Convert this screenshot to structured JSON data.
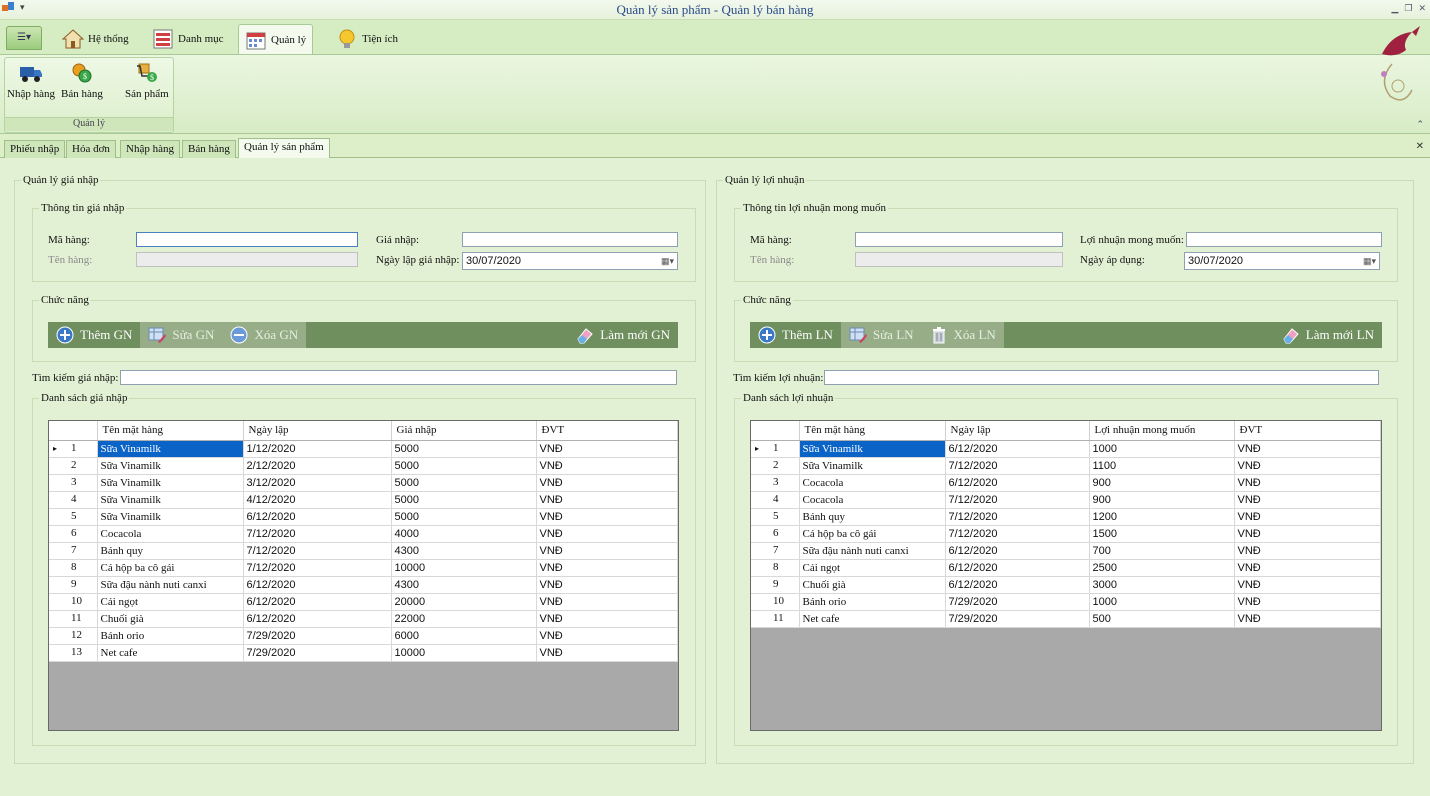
{
  "window": {
    "title": "Quản lý sản phẩm - Quản lý bán hàng"
  },
  "ribbon": {
    "tabs": [
      {
        "label": "Hệ thống"
      },
      {
        "label": "Danh mục"
      },
      {
        "label": "Quản lý"
      },
      {
        "label": "Tiện ích"
      }
    ],
    "active_tab": "Quản lý",
    "group": {
      "name": "Quản lý",
      "buttons": [
        {
          "label": "Nhập hàng",
          "icon": "truck-icon"
        },
        {
          "label": "Bán hàng",
          "icon": "coins-icon"
        },
        {
          "label": "Sản phẩm",
          "icon": "cart-icon"
        }
      ]
    }
  },
  "doc_tabs": [
    {
      "label": "Phiếu nhập"
    },
    {
      "label": "Hóa đơn"
    },
    {
      "label": "Nhập hàng"
    },
    {
      "label": "Bán hàng"
    },
    {
      "label": "Quản lý sản phẩm"
    }
  ],
  "left": {
    "title": "Quản lý giá nhập",
    "info": {
      "title": "Thông tin giá nhập",
      "ma_hang_label": "Mã hàng:",
      "ma_hang_value": "",
      "ten_hang_label": "Tên hàng:",
      "ten_hang_value": "",
      "gia_nhap_label": "Giá nhập:",
      "gia_nhap_value": "",
      "ngay_lap_label": "Ngày lập giá nhập:",
      "ngay_lap_value": "30/07/2020"
    },
    "functions": {
      "title": "Chức năng",
      "add": "Thêm GN",
      "edit": "Sửa GN",
      "delete": "Xóa GN",
      "refresh": "Làm mới GN"
    },
    "search_label": "Tìm kiếm giá nhập:",
    "search_value": "",
    "list": {
      "title": "Danh sách giá nhập",
      "columns": [
        "Tên mặt hàng",
        "Ngày lập",
        "Giá nhập",
        "ĐVT"
      ],
      "rows": [
        [
          "1",
          "Sữa Vinamilk",
          "1/12/2020",
          "5000",
          "VNĐ"
        ],
        [
          "2",
          "Sữa Vinamilk",
          "2/12/2020",
          "5000",
          "VNĐ"
        ],
        [
          "3",
          "Sữa Vinamilk",
          "3/12/2020",
          "5000",
          "VNĐ"
        ],
        [
          "4",
          "Sữa Vinamilk",
          "4/12/2020",
          "5000",
          "VNĐ"
        ],
        [
          "5",
          "Sữa Vinamilk",
          "6/12/2020",
          "5000",
          "VNĐ"
        ],
        [
          "6",
          "Cocacola",
          "7/12/2020",
          "4000",
          "VNĐ"
        ],
        [
          "7",
          "Bánh quy",
          "7/12/2020",
          "4300",
          "VNĐ"
        ],
        [
          "8",
          "Cá hộp ba cô gái",
          "7/12/2020",
          "10000",
          "VNĐ"
        ],
        [
          "9",
          "Sữa đậu nành nuti canxi",
          "6/12/2020",
          "4300",
          "VNĐ"
        ],
        [
          "10",
          "Cải ngọt",
          "6/12/2020",
          "20000",
          "VNĐ"
        ],
        [
          "11",
          "Chuối già",
          "6/12/2020",
          "22000",
          "VNĐ"
        ],
        [
          "12",
          "Bánh orio",
          "7/29/2020",
          "6000",
          "VNĐ"
        ],
        [
          "13",
          "Net cafe",
          "7/29/2020",
          "10000",
          "VNĐ"
        ]
      ]
    }
  },
  "right": {
    "title": "Quản lý lợi nhuận",
    "info": {
      "title": "Thông tin lợi nhuận mong muốn",
      "ma_hang_label": "Mã hàng:",
      "ma_hang_value": "",
      "ten_hang_label": "Tên hàng:",
      "ten_hang_value": "",
      "loi_nhuan_label": "Lợi nhuận mong muốn:",
      "loi_nhuan_value": "",
      "ngay_ad_label": "Ngày áp dụng:",
      "ngay_ad_value": "30/07/2020"
    },
    "functions": {
      "title": "Chức năng",
      "add": "Thêm LN",
      "edit": "Sửa LN",
      "delete": "Xóa LN",
      "refresh": "Làm mới LN"
    },
    "search_label": "Tìm kiếm lợi nhuận:",
    "search_value": "",
    "list": {
      "title": "Danh sách lợi nhuận",
      "columns": [
        "Tên mặt hàng",
        "Ngày lập",
        "Lợi nhuận mong muốn",
        "ĐVT"
      ],
      "rows": [
        [
          "1",
          "Sữa Vinamilk",
          "6/12/2020",
          "1000",
          "VNĐ"
        ],
        [
          "2",
          "Sữa Vinamilk",
          "7/12/2020",
          "1100",
          "VNĐ"
        ],
        [
          "3",
          "Cocacola",
          "6/12/2020",
          "900",
          "VNĐ"
        ],
        [
          "4",
          "Cocacola",
          "7/12/2020",
          "900",
          "VNĐ"
        ],
        [
          "5",
          "Bánh quy",
          "7/12/2020",
          "1200",
          "VNĐ"
        ],
        [
          "6",
          "Cá hộp ba cô gái",
          "7/12/2020",
          "1500",
          "VNĐ"
        ],
        [
          "7",
          "Sữa đậu nành nuti canxi",
          "6/12/2020",
          "700",
          "VNĐ"
        ],
        [
          "8",
          "Cải ngọt",
          "6/12/2020",
          "2500",
          "VNĐ"
        ],
        [
          "9",
          "Chuối già",
          "6/12/2020",
          "3000",
          "VNĐ"
        ],
        [
          "10",
          "Bánh orio",
          "7/29/2020",
          "1000",
          "VNĐ"
        ],
        [
          "11",
          "Net cafe",
          "7/29/2020",
          "500",
          "VNĐ"
        ]
      ]
    }
  },
  "colors": {
    "toolbar": "#6f8f5e",
    "selection": "#0a64c8",
    "background": "#dcefc8"
  }
}
